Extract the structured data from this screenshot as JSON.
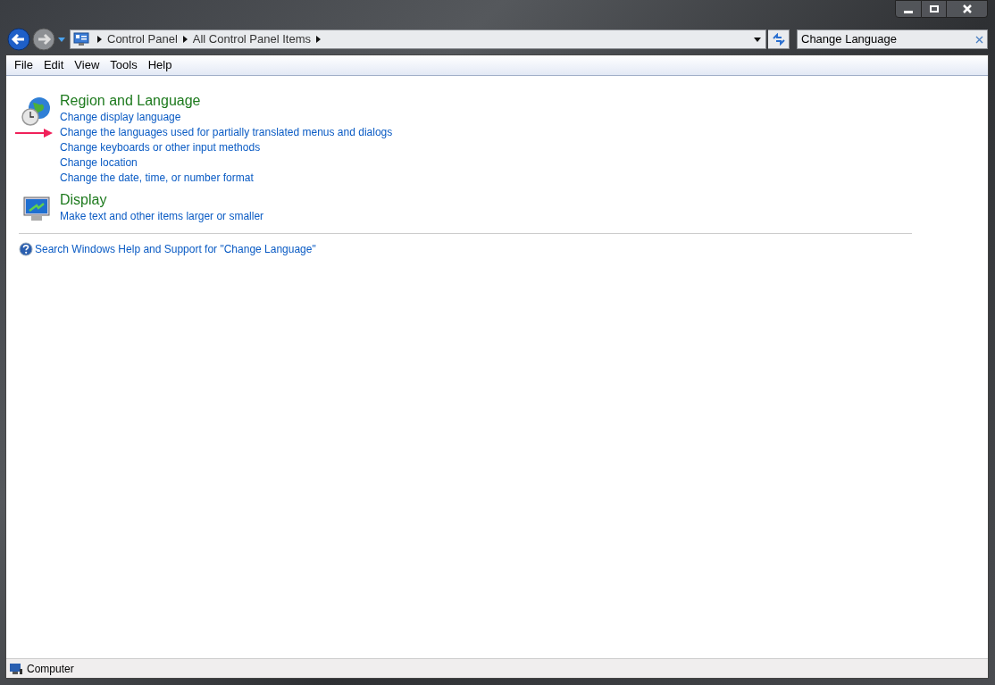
{
  "address_bar": {
    "breadcrumbs": [
      "Control Panel",
      "All Control Panel Items"
    ]
  },
  "search": {
    "value": "Change Language"
  },
  "menu": [
    "File",
    "Edit",
    "View",
    "Tools",
    "Help"
  ],
  "results": [
    {
      "kind": "region",
      "title": "Region and Language",
      "links": [
        {
          "text": "Change display language",
          "arrow": false
        },
        {
          "text": "Change the languages used for partially translated menus and dialogs",
          "arrow": true
        },
        {
          "text": "Change keyboards or other input methods",
          "arrow": false
        },
        {
          "text": "Change location",
          "arrow": false
        },
        {
          "text": "Change the date, time, or number format",
          "arrow": false
        }
      ]
    },
    {
      "kind": "display",
      "title": "Display",
      "links": [
        {
          "text": "Make text and other items larger or smaller",
          "arrow": false
        }
      ]
    }
  ],
  "help_link": "Search Windows Help and Support for \"Change Language\"",
  "status_bar": {
    "text": "Computer"
  }
}
